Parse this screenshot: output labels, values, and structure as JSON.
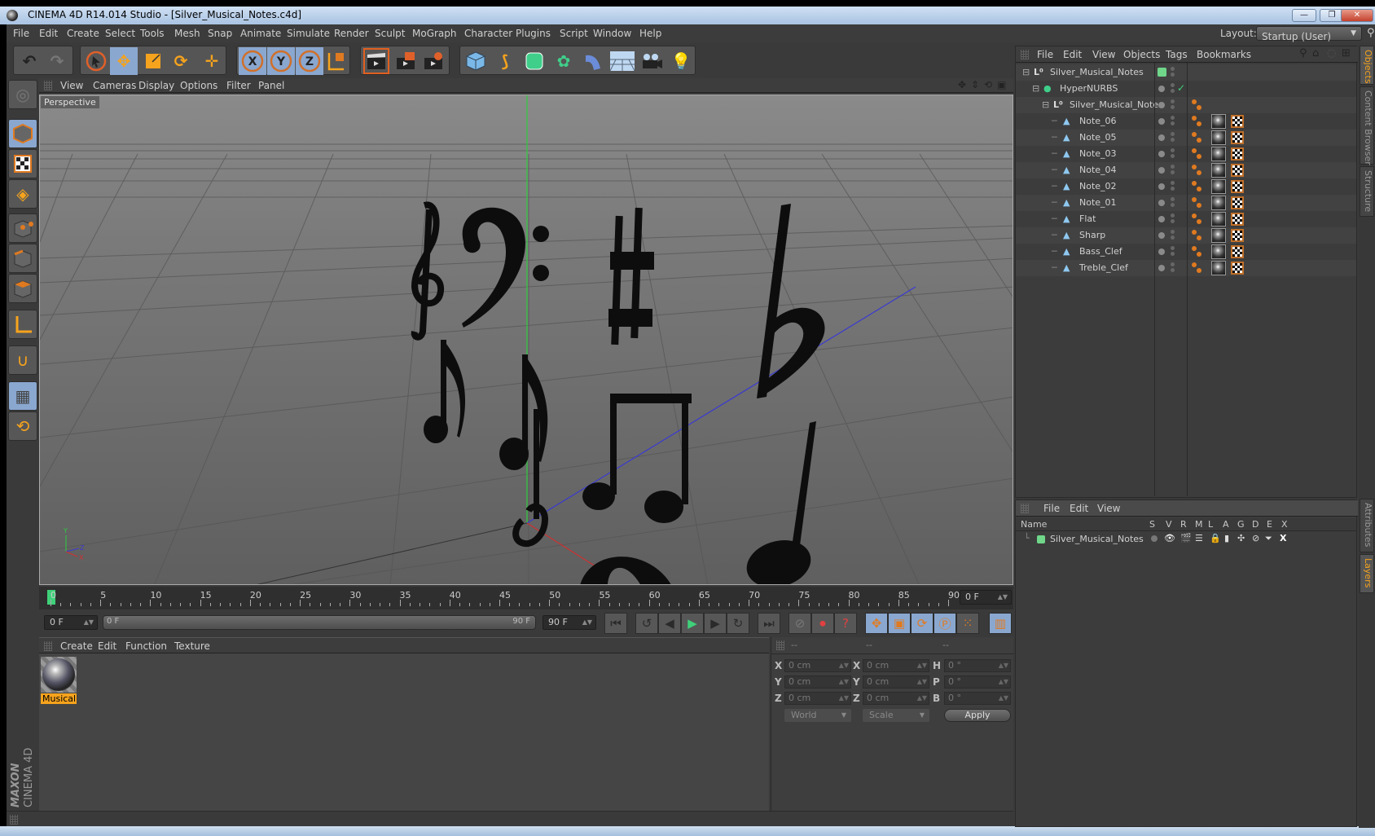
{
  "window": {
    "title": "CINEMA 4D R14.014 Studio - [Silver_Musical_Notes.c4d]",
    "buttons": [
      "minimize",
      "restore",
      "close"
    ]
  },
  "menubar": {
    "items": [
      "File",
      "Edit",
      "Create",
      "Select",
      "Tools",
      "Mesh",
      "Snap",
      "Animate",
      "Simulate",
      "Render",
      "Sculpt",
      "MoGraph",
      "Character",
      "Plugins",
      "Script",
      "Window",
      "Help"
    ],
    "layout_label": "Layout:",
    "layout_value": "Startup (User)"
  },
  "toolbar": {
    "groups": [
      {
        "name": "history",
        "icons": [
          "undo-icon",
          "redo-icon"
        ]
      },
      {
        "name": "tools",
        "icons": [
          "live-select-icon",
          "move-icon",
          "scale-icon",
          "rotate-icon"
        ]
      },
      {
        "name": "recent",
        "icons": [
          "recent-tool-icon"
        ]
      },
      {
        "name": "axis-lock",
        "icons": [
          "x-axis-icon",
          "y-axis-icon",
          "z-axis-icon",
          "coordinate-system-icon"
        ]
      },
      {
        "name": "render",
        "icons": [
          "render-view-icon",
          "render-picture-viewer-icon",
          "render-settings-icon"
        ]
      },
      {
        "name": "create",
        "icons": [
          "cube-icon",
          "spline-pen-icon",
          "subdivision-surface-icon",
          "array-icon",
          "bend-deformer-icon",
          "floor-icon",
          "camera-icon",
          "light-icon"
        ]
      }
    ],
    "axis_labels": [
      "X",
      "Y",
      "Z"
    ]
  },
  "left_tools": [
    "make-editable-icon",
    "model-mode-icon",
    "texture-mode-icon",
    "workplane-mode-icon",
    "points-mode-icon",
    "edges-mode-icon",
    "polygons-mode-icon",
    "axis-mode-icon",
    "snap-magnet-icon",
    "workplane-lock-icon",
    "workplane-rotate-icon"
  ],
  "branding": {
    "maxon": "MAXON",
    "product": "CINEMA 4D"
  },
  "viewport": {
    "menu": [
      "View",
      "Cameras",
      "Display",
      "Options",
      "Filter",
      "Panel"
    ],
    "camera_label": "Perspective",
    "nav_icons": [
      "pan-icon",
      "dolly-icon",
      "orbit-icon",
      "maximize-view-icon"
    ],
    "axis_gizmo": [
      "Y",
      "X",
      "Z"
    ]
  },
  "timeline": {
    "start": 0,
    "end": 90,
    "step_labels": [
      0,
      5,
      10,
      15,
      20,
      25,
      30,
      35,
      40,
      45,
      50,
      55,
      60,
      65,
      70,
      75,
      80,
      85,
      90
    ],
    "current_frame": "0 F",
    "current_marker": 0
  },
  "transport": {
    "start_field": "0 F",
    "range_min_label": "0 F",
    "range_max_label": "90 F",
    "end_field": "90 F",
    "buttons": [
      "go-to-start-icon",
      "previous-key-icon",
      "previous-frame-icon",
      "play-icon",
      "next-frame-icon",
      "next-key-icon",
      "go-to-end-icon",
      "autokey-icon",
      "record-icon",
      "keyframe-selection-icon",
      "key-position-icon",
      "key-scale-icon",
      "key-rotation-icon",
      "key-parameter-icon",
      "key-pla-icon",
      "scheme-icon"
    ]
  },
  "material_manager": {
    "menu": [
      "Create",
      "Edit",
      "Function",
      "Texture"
    ],
    "materials": [
      {
        "name": "Musical"
      }
    ]
  },
  "coordinates": {
    "headers": [
      "--",
      "--",
      "--"
    ],
    "rows": [
      {
        "pos_label": "X",
        "pos": "0 cm",
        "size_label": "X",
        "size": "0 cm",
        "rot_label": "H",
        "rot": "0 °"
      },
      {
        "pos_label": "Y",
        "pos": "0 cm",
        "size_label": "Y",
        "size": "0 cm",
        "rot_label": "P",
        "rot": "0 °"
      },
      {
        "pos_label": "Z",
        "pos": "0 cm",
        "size_label": "Z",
        "size": "0 cm",
        "rot_label": "B",
        "rot": "0 °"
      }
    ],
    "space_dropdown": "World",
    "mode_dropdown": "Scale",
    "apply_label": "Apply"
  },
  "object_manager": {
    "menu": [
      "File",
      "Edit",
      "View",
      "Objects",
      "Tags",
      "Bookmarks"
    ],
    "tool_icons": [
      "search-icon",
      "home-icon",
      "eye-icon",
      "new-view-icon"
    ],
    "objects": [
      {
        "name": "Silver_Musical_Notes",
        "type": "null",
        "level": 0,
        "layer_color": "#6fd68a",
        "check": false,
        "tags": []
      },
      {
        "name": "HyperNURBS",
        "type": "hypernurbs",
        "level": 1,
        "check": true,
        "tags": []
      },
      {
        "name": "Silver_Musical_Notes",
        "type": "null",
        "level": 2,
        "check": false,
        "tags": [
          "phong"
        ]
      },
      {
        "name": "Note_06",
        "type": "polygon",
        "level": 3,
        "tags": [
          "phong",
          "material",
          "uvw"
        ]
      },
      {
        "name": "Note_05",
        "type": "polygon",
        "level": 3,
        "tags": [
          "phong",
          "material",
          "uvw"
        ]
      },
      {
        "name": "Note_03",
        "type": "polygon",
        "level": 3,
        "tags": [
          "phong",
          "material",
          "uvw"
        ]
      },
      {
        "name": "Note_04",
        "type": "polygon",
        "level": 3,
        "tags": [
          "phong",
          "material",
          "uvw"
        ]
      },
      {
        "name": "Note_02",
        "type": "polygon",
        "level": 3,
        "tags": [
          "phong",
          "material",
          "uvw"
        ]
      },
      {
        "name": "Note_01",
        "type": "polygon",
        "level": 3,
        "tags": [
          "phong",
          "material",
          "uvw"
        ]
      },
      {
        "name": "Flat",
        "type": "polygon",
        "level": 3,
        "tags": [
          "phong",
          "material",
          "uvw"
        ]
      },
      {
        "name": "Sharp",
        "type": "polygon",
        "level": 3,
        "tags": [
          "phong",
          "material",
          "uvw"
        ]
      },
      {
        "name": "Bass_Clef",
        "type": "polygon",
        "level": 3,
        "tags": [
          "phong",
          "material",
          "uvw"
        ]
      },
      {
        "name": "Treble_Clef",
        "type": "polygon",
        "level": 3,
        "tags": [
          "phong",
          "material",
          "uvw"
        ]
      }
    ]
  },
  "layer_manager": {
    "menu": [
      "File",
      "Edit",
      "View"
    ],
    "columns": [
      "Name",
      "S",
      "V",
      "R",
      "M",
      "L",
      "A",
      "G",
      "D",
      "E",
      "X"
    ],
    "layers": [
      {
        "name": "Silver_Musical_Notes",
        "color": "#6fd68a"
      }
    ]
  },
  "side_tabs": {
    "top": [
      {
        "label": "Objects",
        "active": true
      },
      {
        "label": "Content Browser",
        "active": false
      },
      {
        "label": "Structure",
        "active": false
      }
    ],
    "bottom": [
      {
        "label": "Attributes",
        "active": false
      },
      {
        "label": "Layers",
        "active": true
      }
    ]
  },
  "colors": {
    "accent_orange": "#f6a31d",
    "active_blue": "#8aa7cf",
    "layer_green": "#6fd68a",
    "play_green": "#3fd17a",
    "y_axis": "#2ecc40",
    "x_axis": "#d03030",
    "z_axis": "#3a3ad0"
  }
}
